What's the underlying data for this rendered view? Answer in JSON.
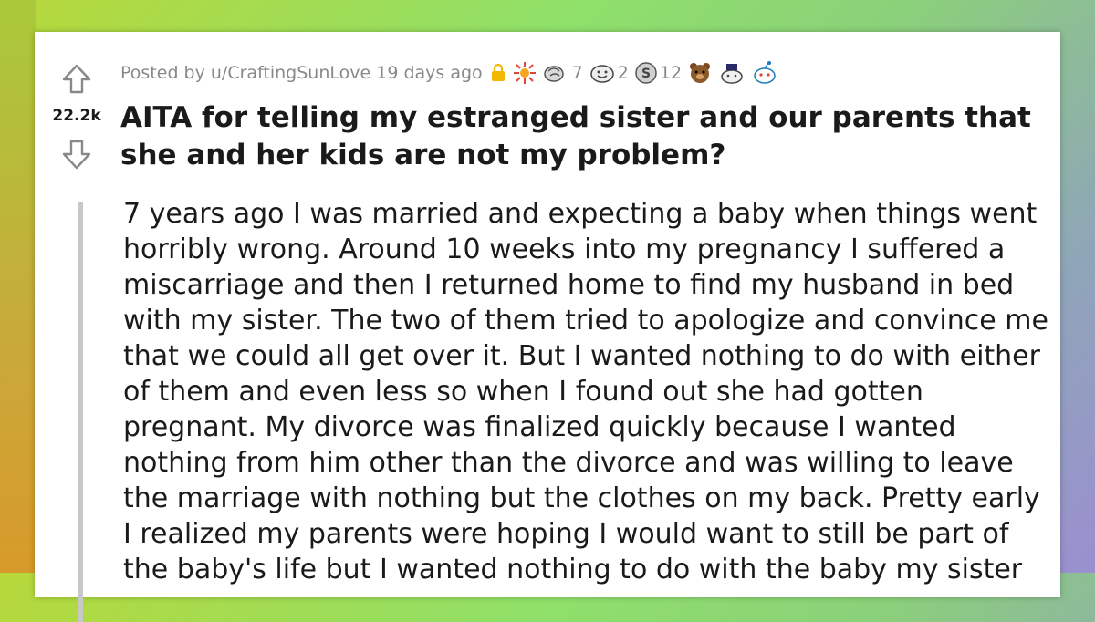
{
  "post": {
    "score": "22.2k",
    "posted_by": "Posted by u/CraftingSunLove 19 days ago",
    "awards": [
      {
        "icon": "sparkle-award-icon",
        "count": ""
      },
      {
        "icon": "hands-award-icon",
        "count": "7"
      },
      {
        "icon": "smile-award-icon",
        "count": "2"
      },
      {
        "icon": "silver-coin-award-icon",
        "count": "12"
      },
      {
        "icon": "bear-award-icon",
        "count": ""
      },
      {
        "icon": "hat-award-icon",
        "count": ""
      },
      {
        "icon": "snoo-award-icon",
        "count": ""
      }
    ],
    "title": "AITA for telling my estranged sister and our parents that she and her kids are not my problem?",
    "body": "7 years ago I was married and expecting a baby when things went horribly wrong. Around 10 weeks into my pregnancy I suffered a miscarriage and then I returned home to find my husband in bed with my sister. The two of them tried to apologize and convince me that we could all get over it. But I wanted nothing to do with either of them and even less so when I found out she had gotten pregnant. My divorce was finalized quickly because I wanted nothing from him other than the divorce and was willing to leave the marriage with nothing but the clothes on my back. Pretty early I realized my parents were hoping I would want to still be part of the baby's life but I wanted nothing to do with the baby my sister"
  },
  "colors": {
    "text": "#1a1a1b",
    "meta": "#878a8c",
    "quote_bar": "#c8c8c8",
    "lock": "#f2b705"
  }
}
